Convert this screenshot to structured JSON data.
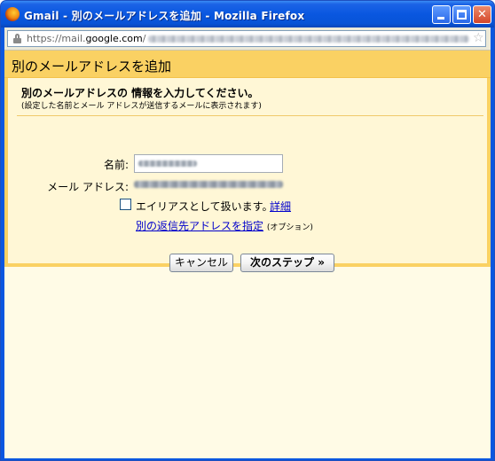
{
  "window": {
    "title": "Gmail - 別のメールアドレスを追加 - Mozilla Firefox",
    "icon": "firefox-icon"
  },
  "address_bar": {
    "prefix": "https://mail.",
    "domain": "google.com",
    "path_sep": "/"
  },
  "dialog": {
    "title": "別のメールアドレスを追加",
    "instruction": "別のメールアドレスの 情報を入力してください。",
    "instruction_note": "(設定した名前とメール アドレスが送信するメールに表示されます)",
    "name_label": "名前:",
    "email_label": "メール アドレス:",
    "alias_checkbox_label": "エイリアスとして扱います。",
    "alias_checked": false,
    "details_link": "詳細",
    "reply_to_link": "別の返信先アドレスを指定",
    "optional_note": "(オプション)",
    "cancel_button": "キャンセル",
    "next_button": "次のステップ »"
  },
  "colors": {
    "titlebar": "#0957e0",
    "dialog_header": "#fad163",
    "panel_background": "#fff7d6",
    "page_background": "#fffbe6",
    "link": "#0000cc"
  }
}
